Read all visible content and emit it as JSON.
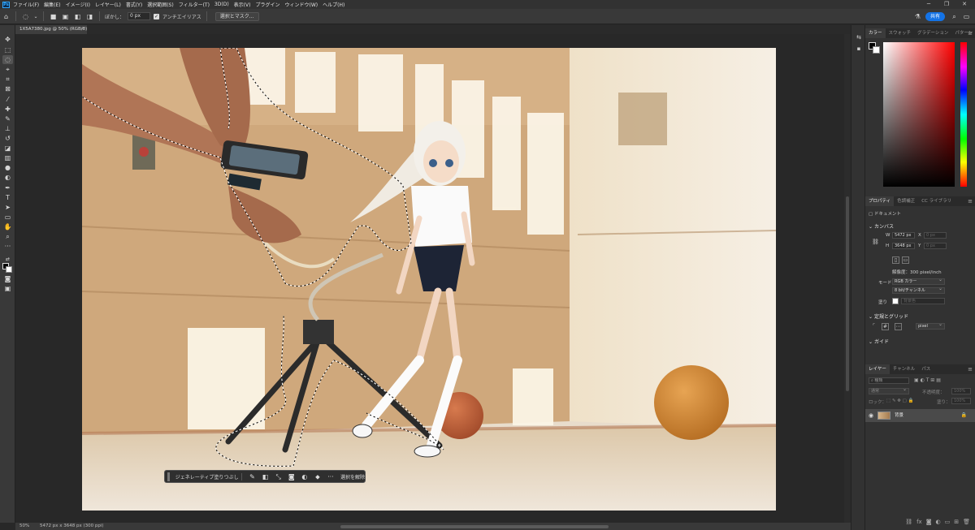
{
  "app": {
    "logo": "Ps"
  },
  "menus": [
    "ファイル(F)",
    "編集(E)",
    "イメージ(I)",
    "レイヤー(L)",
    "書式(Y)",
    "選択範囲(S)",
    "フィルター(T)",
    "3D(D)",
    "表示(V)",
    "プラグイン",
    "ウィンドウ(W)",
    "ヘルプ(H)"
  ],
  "window_controls": {
    "minimize": "─",
    "restore": "❐",
    "close": "✕"
  },
  "options": {
    "feather_label": "ぼかし：",
    "feather_value": "0 px",
    "antialias_label": "アンチエイリアス",
    "mask_button": "選択とマスク...",
    "share": "共有"
  },
  "document": {
    "tab_title": "1X5A7380.jpg @ 50% (RGB/8)",
    "close": "×",
    "zoom": "50%",
    "info": "5472 px x 3648 px (300 ppi)"
  },
  "taskbar": {
    "generative_fill": "ジェネレーティブ塗りつぶし",
    "more": "···",
    "deselect": "選択を解除"
  },
  "color_panel": {
    "tabs": [
      "カラー",
      "スウォッチ",
      "グラデーション",
      "パターン"
    ],
    "foreground": "#000000",
    "background": "#ffffff"
  },
  "properties": {
    "tabs": [
      "プロパティ",
      "色調補正",
      "CC ライブラリ"
    ],
    "doc_label": "ドキュメント",
    "canvas_title": "カンバス",
    "w_label": "W",
    "w_value": "5472 px",
    "x_label": "X",
    "x_value": "0 px",
    "h_label": "H",
    "h_value": "3648 px",
    "y_label": "Y",
    "y_value": "0 px",
    "resolution": "解像度：300 pixel/inch",
    "mode_label": "モード",
    "mode_value": "RGB カラー",
    "bit_value": "8 bit/チャンネル",
    "fill_label": "塗り",
    "fill_value": "背景色",
    "rulers_title": "定規とグリッド",
    "unit_value": "pixel",
    "guides_title": "ガイド"
  },
  "layers": {
    "tabs": [
      "レイヤー",
      "チャンネル",
      "パス"
    ],
    "search_placeholder": "種類",
    "blend_mode": "通常",
    "opacity_label": "不透明度：",
    "opacity_value": "100%",
    "lock_label": "ロック：",
    "fill_label": "塗り：",
    "fill_value": "100%",
    "layer_name": "背景"
  }
}
